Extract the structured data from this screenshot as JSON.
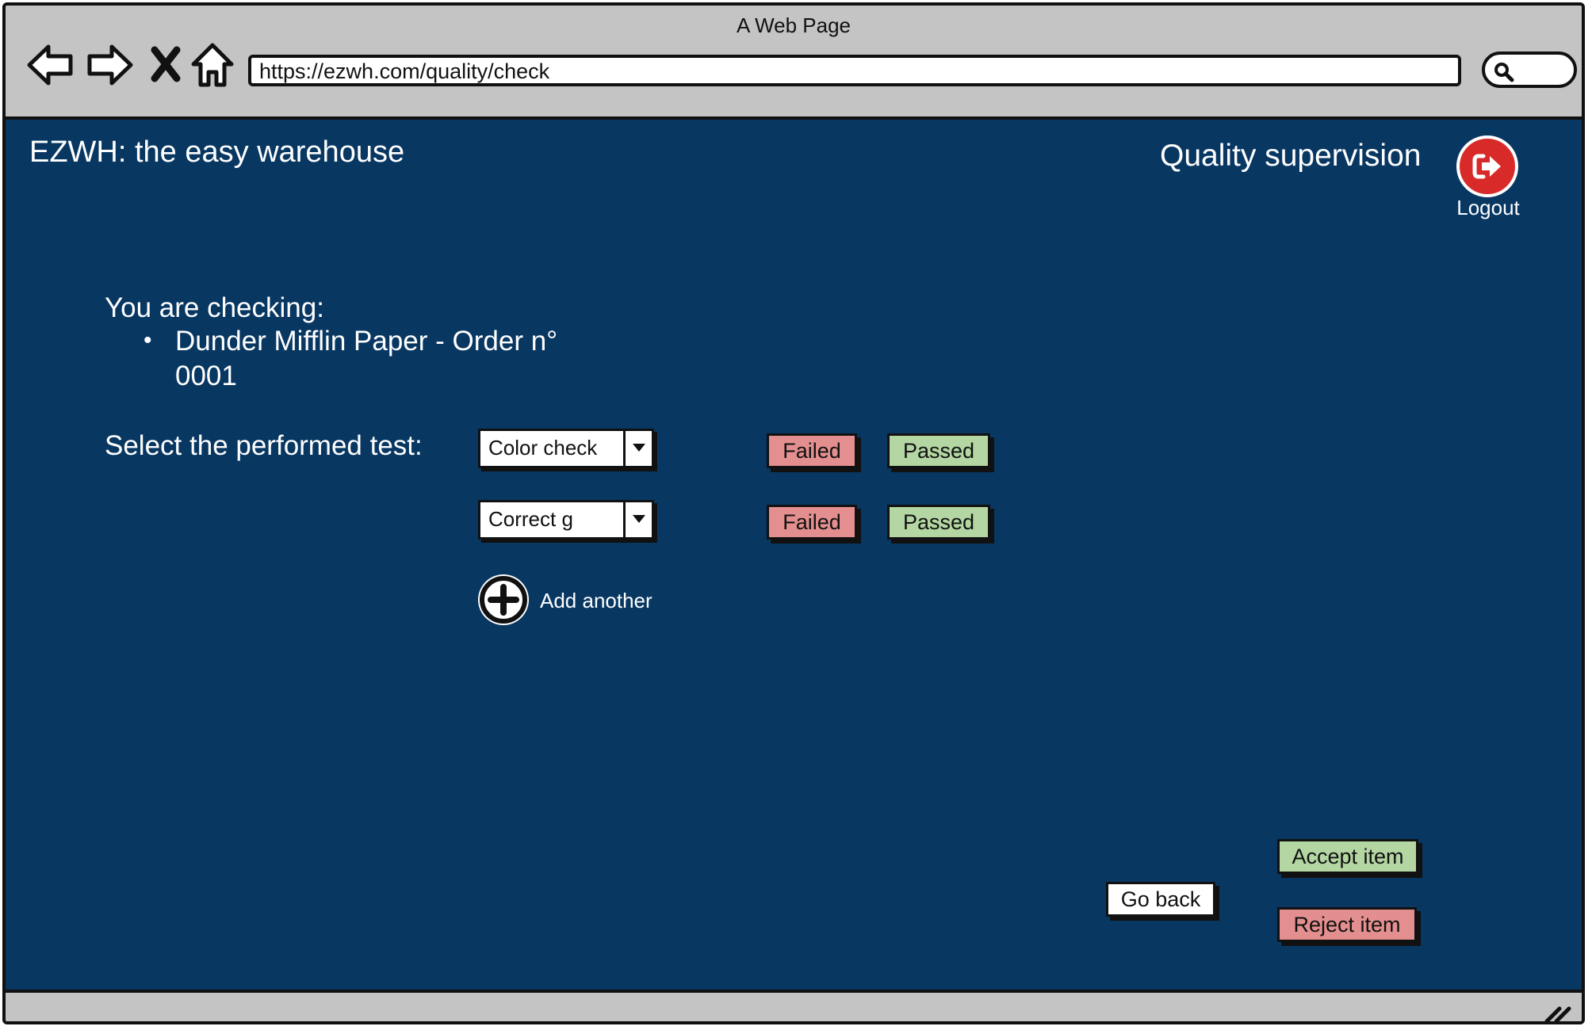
{
  "window": {
    "title": "A Web Page"
  },
  "browser": {
    "url": "https://ezwh.com/quality/check"
  },
  "header": {
    "brand": "EZWH: the easy warehouse",
    "section_title": "Quality supervision",
    "logout_label": "Logout"
  },
  "checking": {
    "intro": "You are checking:",
    "item": "Dunder Mifflin Paper - Order n° 0001"
  },
  "tests": {
    "label": "Select the performed test:",
    "rows": [
      {
        "selected": "Color check",
        "failed_label": "Failed",
        "passed_label": "Passed"
      },
      {
        "selected": "Correct g",
        "failed_label": "Failed",
        "passed_label": "Passed"
      }
    ],
    "add_label": "Add another"
  },
  "actions": {
    "go_back": "Go back",
    "accept": "Accept item",
    "reject": "Reject item"
  },
  "colors": {
    "background": "#083762",
    "failed": "#e48f8f",
    "passed": "#b3d6a3",
    "logout": "#d92a2a",
    "chrome": "#c4c4c4"
  },
  "icons": [
    "back-arrow-icon",
    "forward-arrow-icon",
    "stop-icon",
    "home-icon",
    "search-icon",
    "logout-icon",
    "chevron-down-icon",
    "plus-circle-icon",
    "resize-grip-icon"
  ]
}
